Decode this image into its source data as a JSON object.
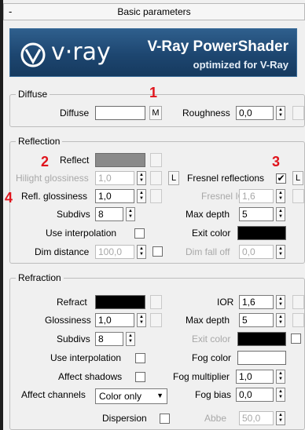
{
  "rollout": {
    "toggle": "-",
    "title": "Basic parameters"
  },
  "banner": {
    "logo": "v·ray",
    "title": "V-Ray PowerShader",
    "subtitle": "optimized for V-Ray"
  },
  "annotations": [
    "1",
    "2",
    "3",
    "4"
  ],
  "diffuse": {
    "group_title": "Diffuse",
    "diffuse_label": "Diffuse",
    "diffuse_color": "#ffffff",
    "map_btn": "M",
    "roughness_label": "Roughness",
    "roughness_value": "0,0"
  },
  "reflection": {
    "group_title": "Reflection",
    "reflect_label": "Reflect",
    "reflect_color": "#8a8a8a",
    "hilight_label": "Hilight glossiness",
    "hilight_value": "1,0",
    "lock_btn": "L",
    "fresnel_label": "Fresnel reflections",
    "fresnel_checked": "✔",
    "fresnel_lock": "L",
    "refl_gloss_label": "Refl. glossiness",
    "refl_gloss_value": "1,0",
    "fresnel_ior_label": "Fresnel IOR",
    "fresnel_ior_value": "1,6",
    "subdivs_label": "Subdivs",
    "subdivs_value": "8",
    "max_depth_label": "Max depth",
    "max_depth_value": "5",
    "use_interp_label": "Use interpolation",
    "exit_color_label": "Exit color",
    "exit_color": "#000000",
    "dim_distance_label": "Dim distance",
    "dim_distance_value": "100,0",
    "dim_falloff_label": "Dim fall off",
    "dim_falloff_value": "0,0"
  },
  "refraction": {
    "group_title": "Refraction",
    "refract_label": "Refract",
    "refract_color": "#000000",
    "ior_label": "IOR",
    "ior_value": "1,6",
    "glossiness_label": "Glossiness",
    "glossiness_value": "1,0",
    "max_depth_label": "Max depth",
    "max_depth_value": "5",
    "subdivs_label": "Subdivs",
    "subdivs_value": "8",
    "exit_color_label": "Exit color",
    "exit_color": "#000000",
    "use_interp_label": "Use interpolation",
    "fog_color_label": "Fog color",
    "fog_color": "#ffffff",
    "affect_shadows_label": "Affect shadows",
    "fog_mult_label": "Fog multiplier",
    "fog_mult_value": "1,0",
    "affect_channels_label": "Affect channels",
    "affect_channels_value": "Color only",
    "fog_bias_label": "Fog bias",
    "fog_bias_value": "0,0",
    "dispersion_label": "Dispersion",
    "abbe_label": "Abbe",
    "abbe_value": "50,0"
  }
}
